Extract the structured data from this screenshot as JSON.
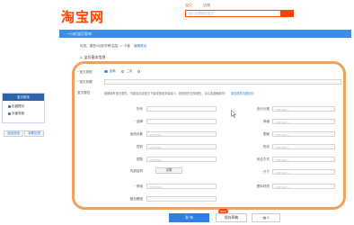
{
  "header": {
    "logo": "淘宝网",
    "search_tabs": [
      "宝贝",
      "店铺"
    ],
    "search_placeholder": "输入你想要的宝贝"
  },
  "blue_bar": {
    "title": "一口价宝贝发布"
  },
  "breadcrumb": {
    "path": "玩具、模型/动漫/早教/益智 >> 卡套",
    "edit_link": "编辑类目"
  },
  "section": {
    "title": "1. 宝贝基本信息"
  },
  "sidebar": {
    "header": "宝贝助手",
    "items": [
      "出错提示",
      "页面导航"
    ],
    "buttons": [
      "返回旧版",
      "我要反馈"
    ]
  },
  "form": {
    "type_label": "宝贝类型",
    "type_options": [
      "全新",
      "二手"
    ],
    "title_label": "宝贝标题",
    "attr_label": "宝贝属性",
    "attr_hint": "错误填写宝贝属性，可能会引起宝贝下架或搜索流量减少，影响您的正常销售，请认真准确填写！",
    "attr_link": "类目属性问题反馈",
    "left_fields": [
      {
        "label": "货号",
        "required": false,
        "value": ""
      },
      {
        "label": "品牌",
        "required": true,
        "value": ""
      },
      {
        "label": "适用对象",
        "required": false,
        "value": "可直接输入"
      },
      {
        "label": "性别",
        "required": false,
        "value": "可直接输入"
      },
      {
        "label": "质数",
        "required": false,
        "value": "可直接输入"
      }
    ],
    "right_fields": [
      {
        "label": "流行元素",
        "value": "可直接输入"
      },
      {
        "label": "风格",
        "value": "可直接输入"
      },
      {
        "label": "图案",
        "value": "可直接输入"
      },
      {
        "label": "形态",
        "value": "可直接输入"
      },
      {
        "label": "闭合方式",
        "value": "可直接输入"
      },
      {
        "label": "尺寸",
        "value": "可直接输入"
      },
      {
        "label": "塑料材质",
        "value": "可直接输入"
      }
    ],
    "inner_label": "内部结构",
    "inner_button": "设置",
    "material_label": "质地",
    "material_value": "可直接输入",
    "bottom_label": "箱包硬度",
    "bottom_value": ""
  },
  "footer": {
    "publish": "发 布",
    "save_draft": "保存草稿",
    "draft_count": "0",
    "new_badge": "NEW"
  }
}
